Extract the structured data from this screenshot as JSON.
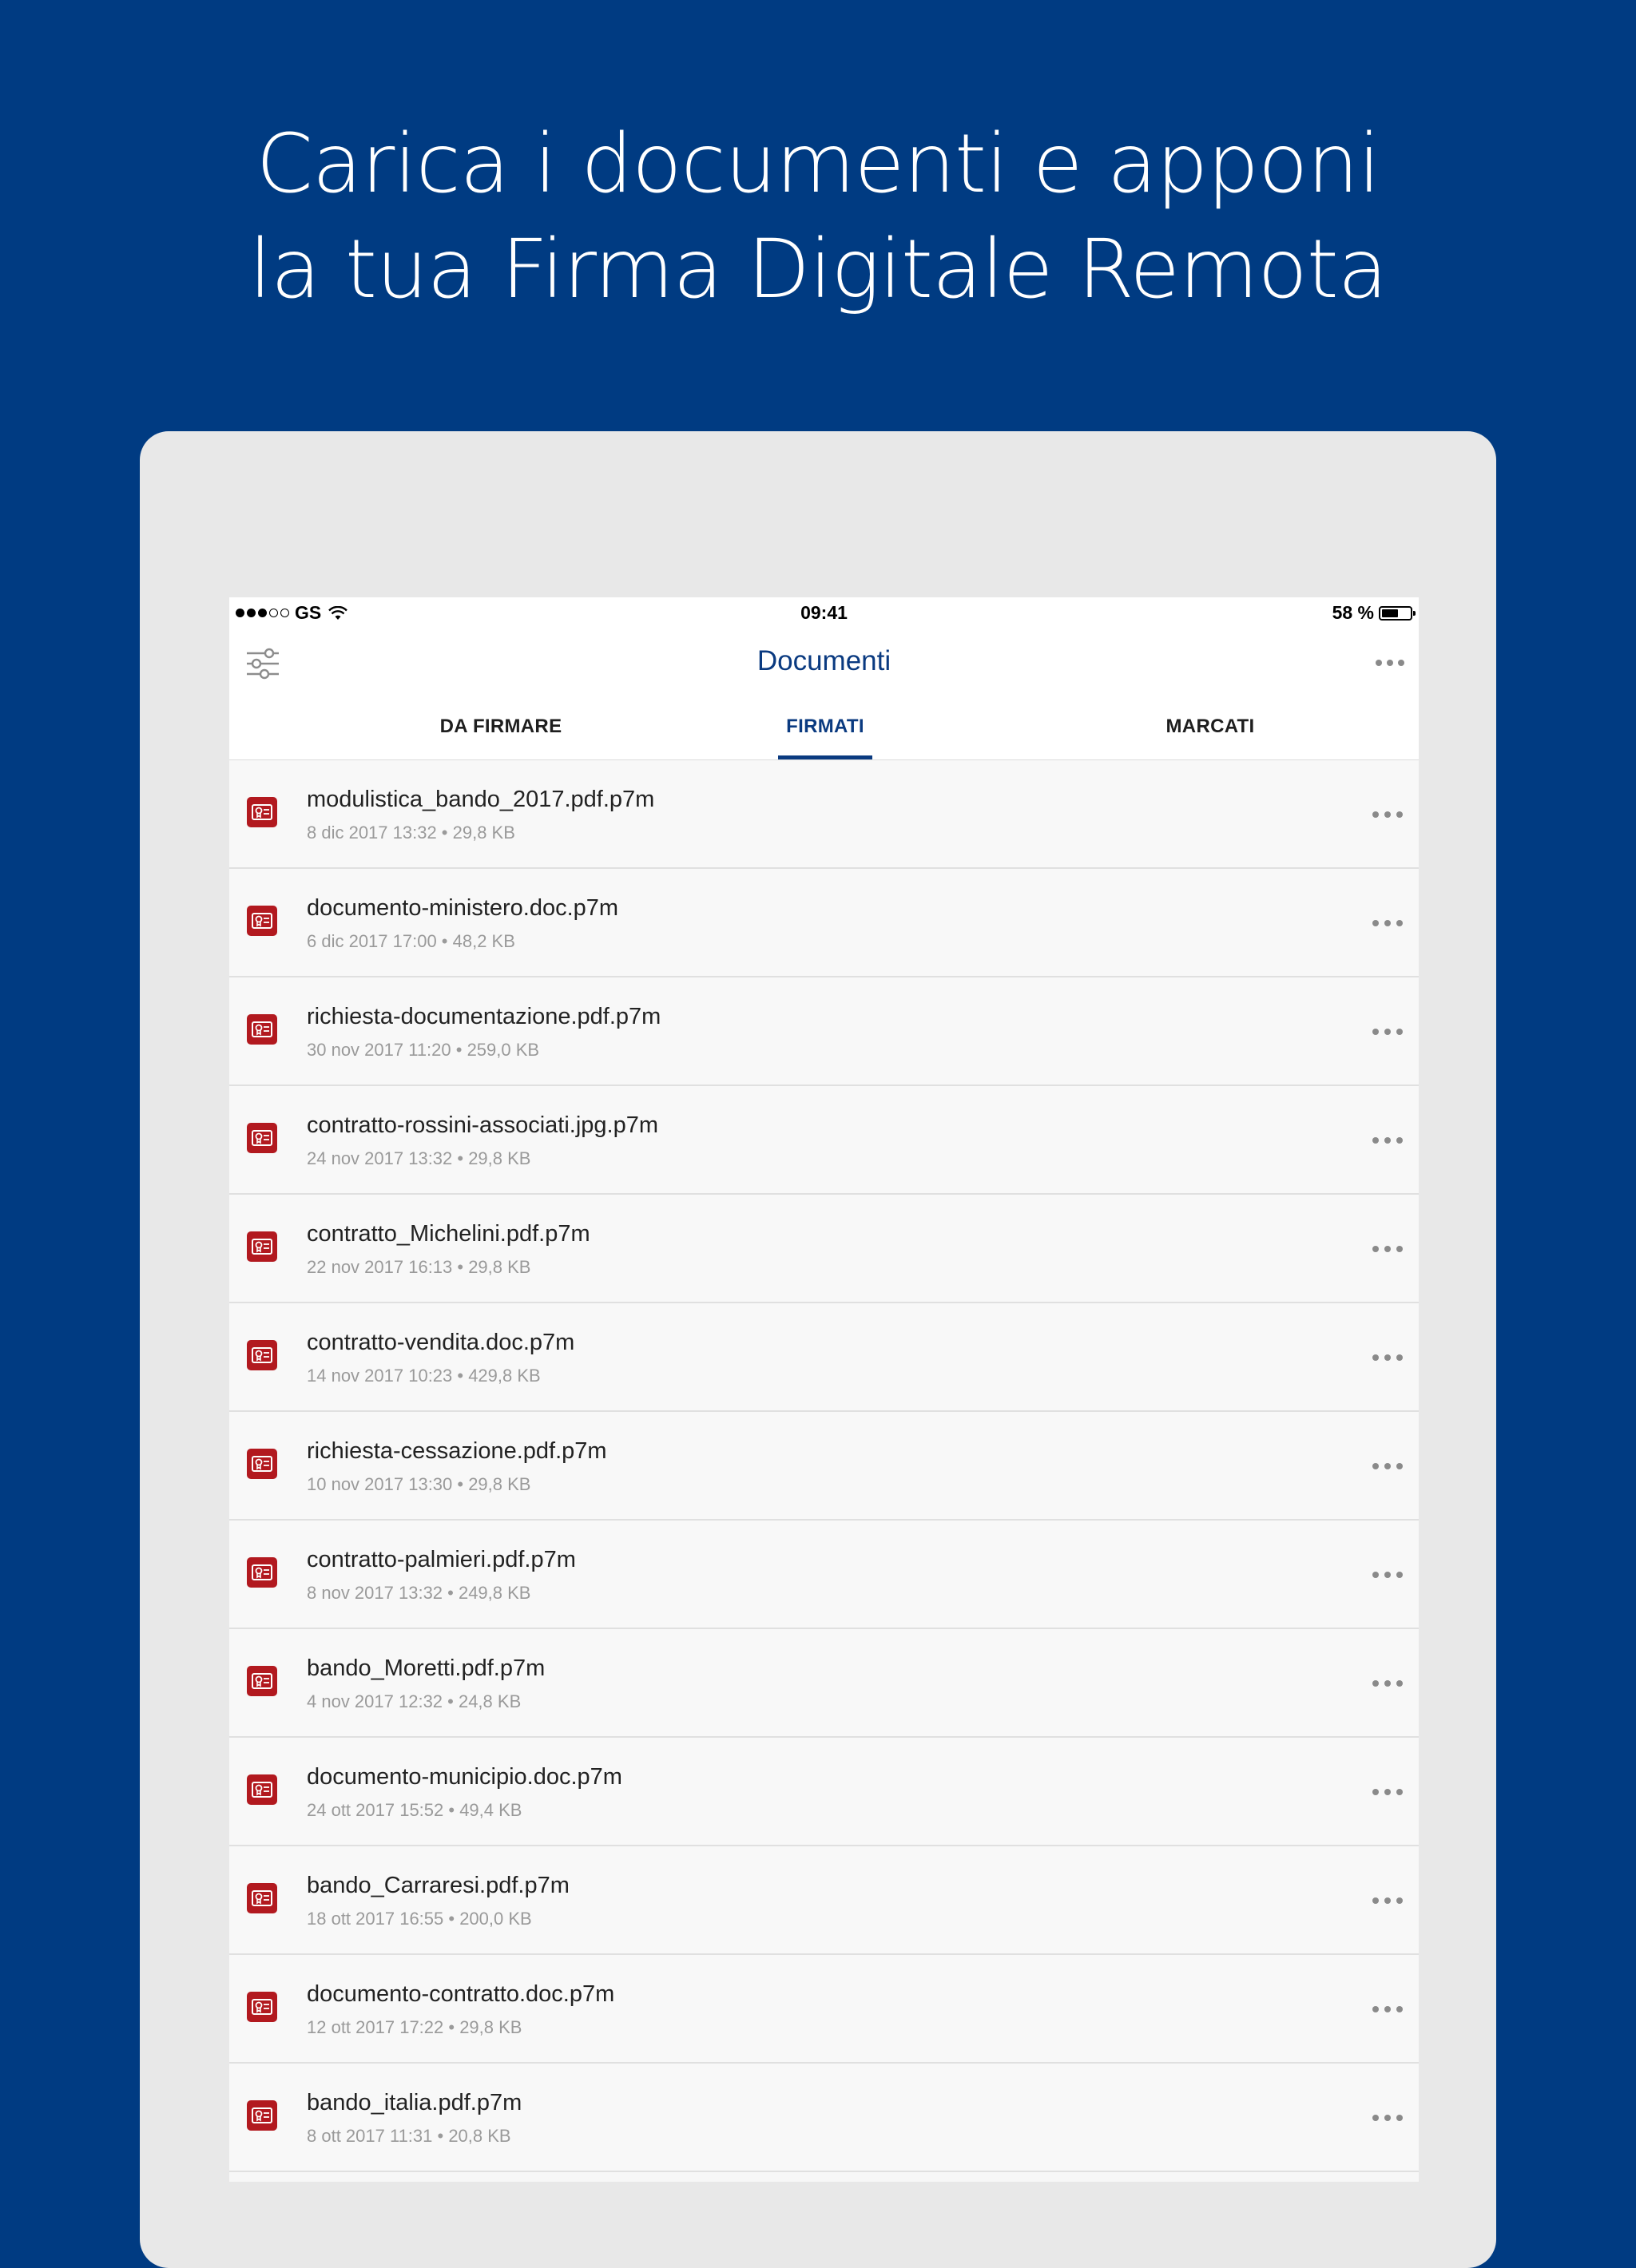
{
  "headline": {
    "line1": "Carica i documenti e apponi",
    "line2": "la tua Firma Digitale Remota"
  },
  "status_bar": {
    "carrier": "GS",
    "time": "09:41",
    "battery_text": "58 %",
    "battery_level": 0.58
  },
  "nav": {
    "title": "Documenti"
  },
  "tabs": [
    {
      "label": "DA FIRMARE",
      "active": false
    },
    {
      "label": "FIRMATI",
      "active": true
    },
    {
      "label": "MARCATI",
      "active": false
    }
  ],
  "documents": [
    {
      "name": "modulistica_bando_2017.pdf.p7m",
      "meta": "8 dic 2017 13:32 • 29,8 KB"
    },
    {
      "name": "documento-ministero.doc.p7m",
      "meta": "6 dic 2017 17:00 • 48,2 KB"
    },
    {
      "name": "richiesta-documentazione.pdf.p7m",
      "meta": "30 nov 2017 11:20 • 259,0 KB"
    },
    {
      "name": "contratto-rossini-associati.jpg.p7m",
      "meta": "24 nov 2017 13:32 • 29,8 KB"
    },
    {
      "name": "contratto_Michelini.pdf.p7m",
      "meta": "22 nov 2017 16:13 • 29,8 KB"
    },
    {
      "name": "contratto-vendita.doc.p7m",
      "meta": "14 nov 2017 10:23 • 429,8 KB"
    },
    {
      "name": "richiesta-cessazione.pdf.p7m",
      "meta": "10 nov 2017 13:30 • 29,8 KB"
    },
    {
      "name": "contratto-palmieri.pdf.p7m",
      "meta": "8 nov 2017 13:32 • 249,8 KB"
    },
    {
      "name": "bando_Moretti.pdf.p7m",
      "meta": "4 nov 2017 12:32 • 24,8 KB"
    },
    {
      "name": "documento-municipio.doc.p7m",
      "meta": "24 ott 2017 15:52 • 49,4 KB"
    },
    {
      "name": "bando_Carraresi.pdf.p7m",
      "meta": "18 ott 2017 16:55 • 200,0 KB"
    },
    {
      "name": "documento-contratto.doc.p7m",
      "meta": "12 ott 2017 17:22 • 29,8 KB"
    },
    {
      "name": "bando_italia.pdf.p7m",
      "meta": "8 ott 2017 11:31 • 20,8 KB"
    }
  ],
  "icons": {
    "file": "signed-document-icon",
    "more": "more-horizontal-icon",
    "filter": "filter-sliders-icon"
  },
  "colors": {
    "background": "#003b82",
    "accent": "#0a3a80",
    "file_icon": "#b2191f"
  }
}
